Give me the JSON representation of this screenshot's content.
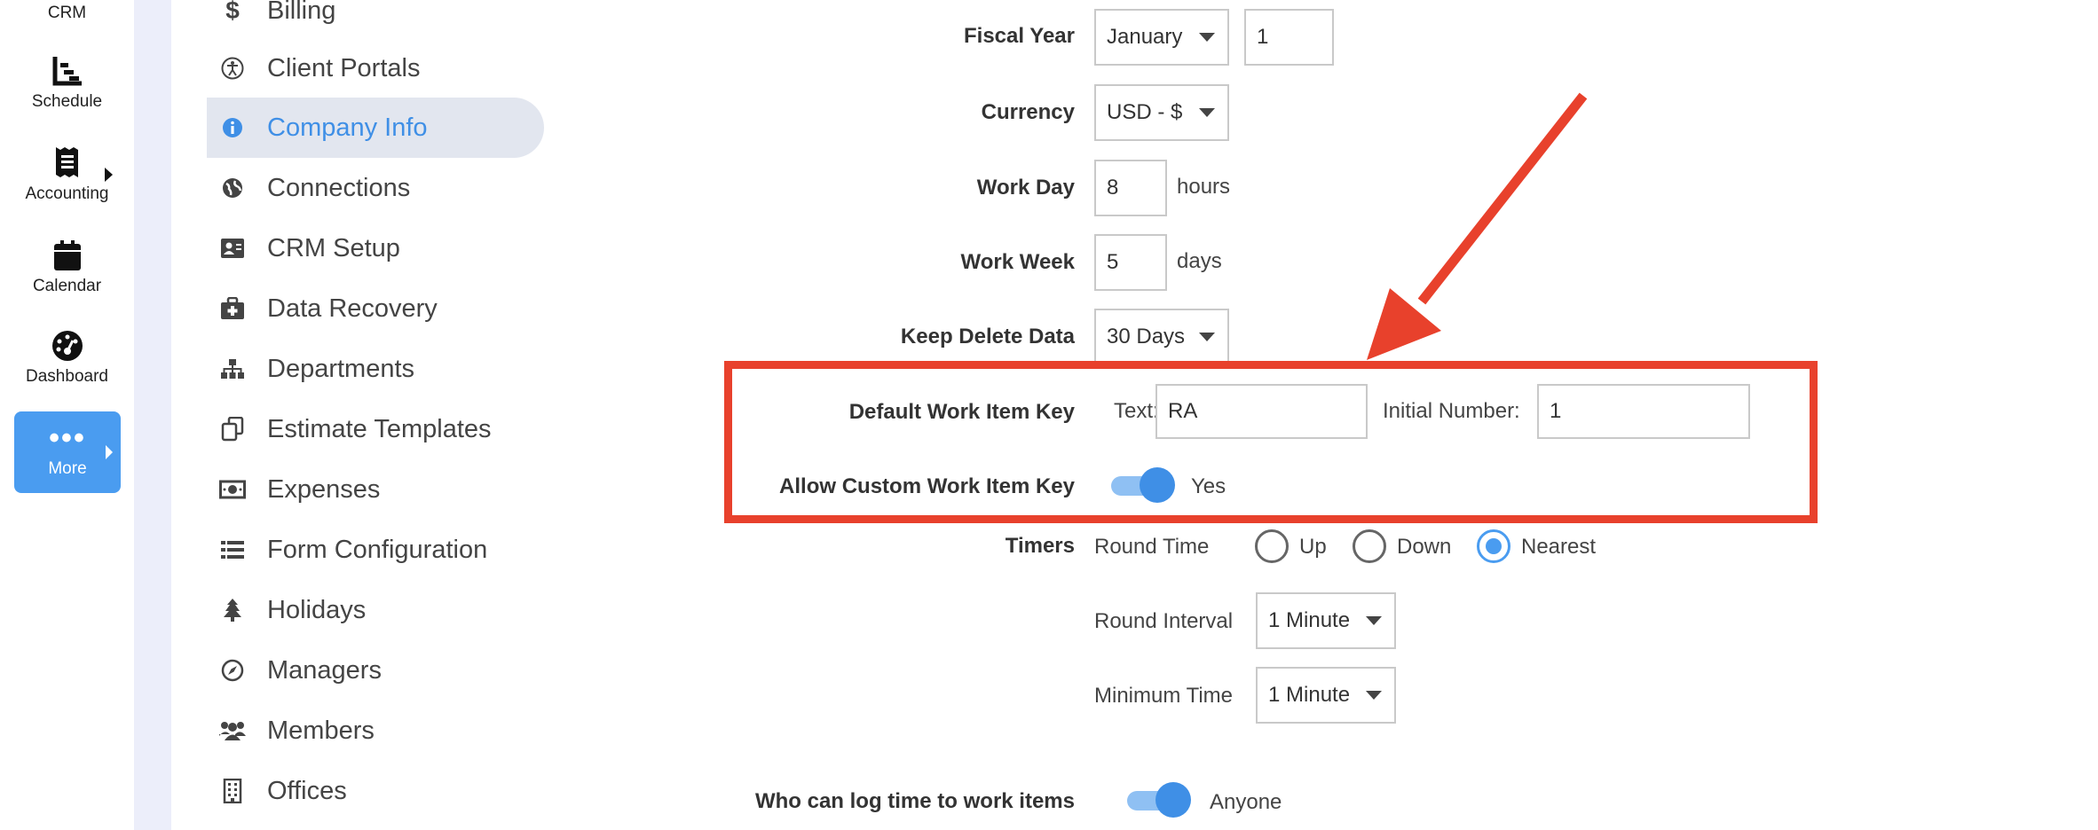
{
  "rail": {
    "items": [
      {
        "label": "CRM",
        "icon": "crm-icon"
      },
      {
        "label": "Schedule",
        "icon": "schedule-icon"
      },
      {
        "label": "Accounting",
        "icon": "receipt-icon"
      },
      {
        "label": "Calendar",
        "icon": "calendar-icon"
      },
      {
        "label": "Dashboard",
        "icon": "gauge-icon"
      }
    ],
    "more": {
      "label": "More",
      "icon": "more-dots-icon"
    }
  },
  "menu": {
    "items": [
      {
        "label": "Billing",
        "icon": "dollar-icon"
      },
      {
        "label": "Client Portals",
        "icon": "accessibility-icon"
      },
      {
        "label": "Company Info",
        "icon": "info-icon",
        "active": true
      },
      {
        "label": "Connections",
        "icon": "globe-icon"
      },
      {
        "label": "CRM Setup",
        "icon": "contact-card-icon"
      },
      {
        "label": "Data Recovery",
        "icon": "medkit-icon"
      },
      {
        "label": "Departments",
        "icon": "sitemap-icon"
      },
      {
        "label": "Estimate Templates",
        "icon": "copy-icon"
      },
      {
        "label": "Expenses",
        "icon": "money-bill-icon"
      },
      {
        "label": "Form Configuration",
        "icon": "list-icon"
      },
      {
        "label": "Holidays",
        "icon": "tree-icon"
      },
      {
        "label": "Managers",
        "icon": "compass-icon"
      },
      {
        "label": "Members",
        "icon": "users-icon"
      },
      {
        "label": "Offices",
        "icon": "building-icon"
      }
    ]
  },
  "form": {
    "fiscal_year": {
      "label": "Fiscal Year",
      "month": "January",
      "day": "1"
    },
    "currency": {
      "label": "Currency",
      "value": "USD - $"
    },
    "work_day": {
      "label": "Work Day",
      "value": "8",
      "unit": "hours"
    },
    "work_week": {
      "label": "Work Week",
      "value": "5",
      "unit": "days"
    },
    "keep_delete": {
      "label": "Keep Delete Data",
      "value": "30 Days"
    },
    "work_item_key": {
      "label": "Default Work Item Key",
      "text_label": "Text:",
      "text_value": "RA",
      "initial_label": "Initial Number:",
      "initial_value": "1"
    },
    "allow_custom": {
      "label": "Allow Custom Work Item Key",
      "value": "Yes",
      "on": true
    },
    "timers": {
      "label": "Timers",
      "round_time_label": "Round Time",
      "options": [
        "Up",
        "Down",
        "Nearest"
      ],
      "selected": "Nearest",
      "round_interval_label": "Round Interval",
      "round_interval_value": "1 Minute",
      "minimum_time_label": "Minimum Time",
      "minimum_time_value": "1 Minute"
    },
    "log_time": {
      "label": "Who can log time to work items",
      "value": "Anyone",
      "on": true
    }
  },
  "annotation": {
    "color": "#e8412c"
  },
  "colors": {
    "accent": "#4a9cf0",
    "active_bg": "#e2e6ef",
    "rail_divider": "#eceefa"
  }
}
